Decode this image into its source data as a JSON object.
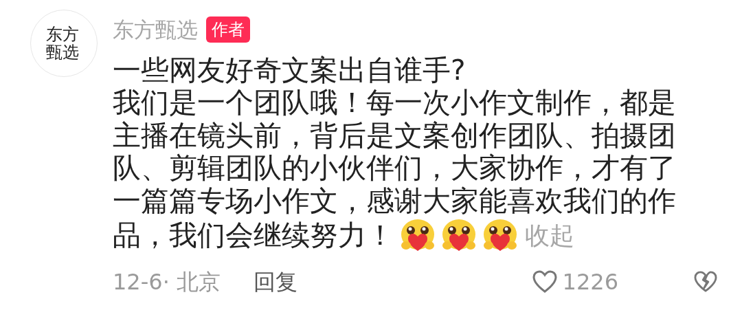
{
  "avatar": {
    "logo_text": "东方甄选"
  },
  "author": {
    "name": "东方甄选",
    "badge": "作者"
  },
  "comment": {
    "lines": [
      "一些网友好奇文案出自谁手?",
      "我们是一个团队哦！每一次小作文制作，都是",
      "主播在镜头前，背后是文案创作团队、拍摄团",
      "队、剪辑团队的小伙伴们，大家协作，才有了",
      "一篇篇专场小作文，感谢大家能喜欢我们的作",
      "品，我们会继续努力！"
    ],
    "stickers": [
      {
        "kind": "heart-hug"
      },
      {
        "kind": "heart-hug"
      },
      {
        "kind": "heart-hug"
      }
    ],
    "collapse": "收起"
  },
  "footer": {
    "meta": "12-6· 北京",
    "reply": "回复",
    "likes": "1226",
    "liked": false
  }
}
